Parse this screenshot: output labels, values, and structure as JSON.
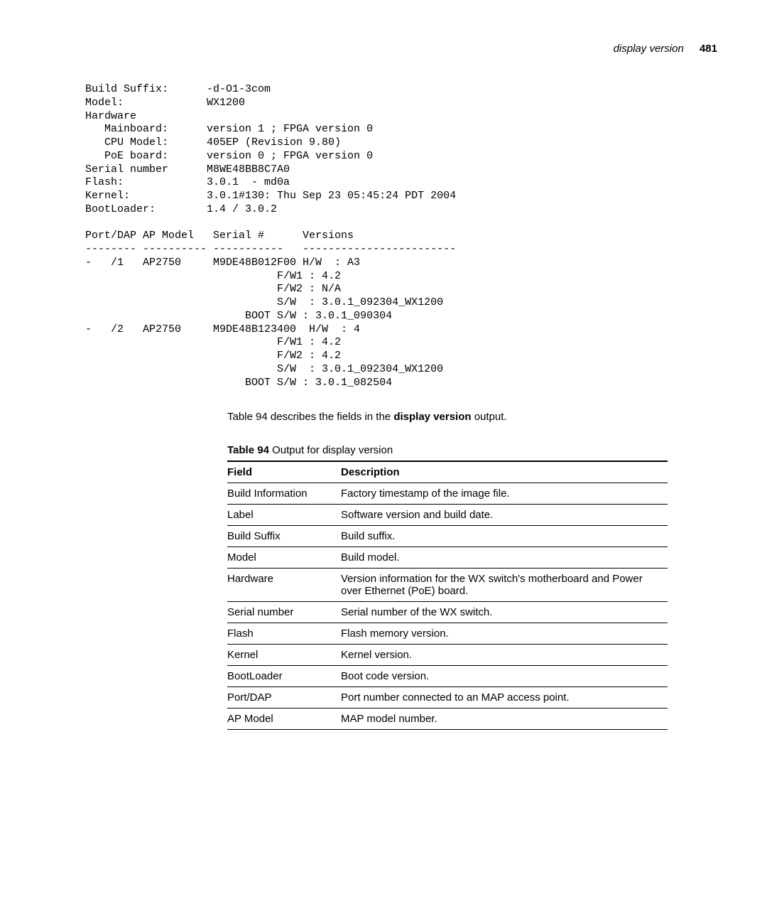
{
  "header": {
    "section": "display version",
    "page": "481"
  },
  "terminal": "Build Suffix:      -d-O1-3com\nModel:             WX1200\nHardware\n   Mainboard:      version 1 ; FPGA version 0\n   CPU Model:      405EP (Revision 9.80)\n   PoE board:      version 0 ; FPGA version 0\nSerial number      M8WE48BB8C7A0\nFlash:             3.0.1  - md0a\nKernel:            3.0.1#130: Thu Sep 23 05:45:24 PDT 2004\nBootLoader:        1.4 / 3.0.2\n\nPort/DAP AP Model   Serial #      Versions\n-------- ---------- -----------   ------------------------\n-   /1   AP2750     M9DE48B012F00 H/W  : A3\n                              F/W1 : 4.2\n                              F/W2 : N/A\n                              S/W  : 3.0.1_092304_WX1200\n                         BOOT S/W : 3.0.1_090304\n-   /2   AP2750     M9DE48B123400  H/W  : 4\n                              F/W1 : 4.2\n                              F/W2 : 4.2\n                              S/W  : 3.0.1_092304_WX1200\n                         BOOT S/W : 3.0.1_082504",
  "caption": {
    "before": "Table 94 describes the fields in the ",
    "bold": "display version",
    "after": " output."
  },
  "table": {
    "title_lead": "Table 94",
    "title_rest": "   Output for display version",
    "headers": {
      "field": "Field",
      "desc": "Description"
    },
    "rows": [
      {
        "field": "Build Information",
        "desc": "Factory timestamp of the image file."
      },
      {
        "field": "Label",
        "desc": "Software version and build date."
      },
      {
        "field": "Build Suffix",
        "desc": "Build suffix."
      },
      {
        "field": "Model",
        "desc": "Build model."
      },
      {
        "field": "Hardware",
        "desc": "Version information for the WX switch's motherboard and Power over Ethernet (PoE) board."
      },
      {
        "field": "Serial number",
        "desc": "Serial number of the WX switch."
      },
      {
        "field": "Flash",
        "desc": "Flash memory version."
      },
      {
        "field": "Kernel",
        "desc": "Kernel version."
      },
      {
        "field": "BootLoader",
        "desc": "Boot code version."
      },
      {
        "field": "Port/DAP",
        "desc": "Port number connected to an MAP access point."
      },
      {
        "field": "AP Model",
        "desc": "MAP model number."
      }
    ]
  }
}
